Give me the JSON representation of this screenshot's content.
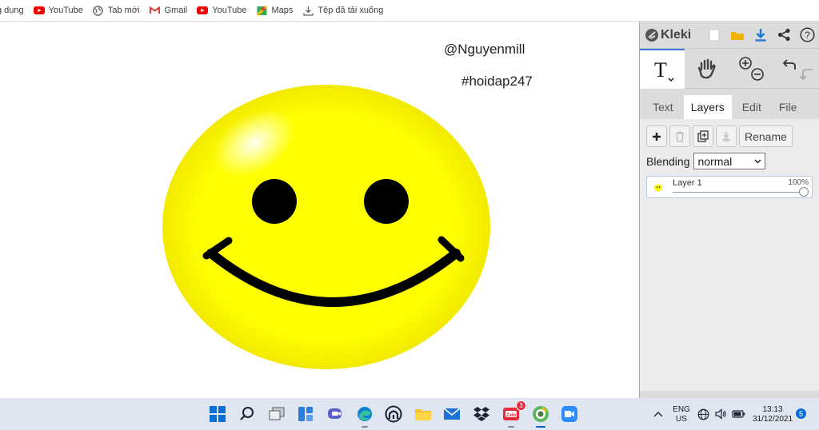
{
  "bookmarks": [
    {
      "label": "g dụng",
      "icon": "apps-icon"
    },
    {
      "label": "YouTube",
      "icon": "youtube-icon"
    },
    {
      "label": "Tab mới",
      "icon": "globe-icon"
    },
    {
      "label": "Gmail",
      "icon": "gmail-icon"
    },
    {
      "label": "YouTube",
      "icon": "youtube-icon"
    },
    {
      "label": "Maps",
      "icon": "maps-icon"
    },
    {
      "label": "Tệp đã tải xuống",
      "icon": "download-icon"
    }
  ],
  "canvas": {
    "text1": "@Nguyenmill",
    "text2": "#hoidap247",
    "colors": {
      "face": "#ffff00",
      "feature": "#000000"
    }
  },
  "panel": {
    "app_name": "Kleki",
    "tabs": [
      "Text",
      "Layers",
      "Edit",
      "File"
    ],
    "active_tab": "Layers",
    "rename_label": "Rename",
    "blending_label": "Blending",
    "blending_value": "normal",
    "layers": [
      {
        "name": "Layer 1",
        "opacity": "100%"
      }
    ],
    "accent": "#3a7bd5"
  },
  "taskbar": {
    "zalo_badge": "3",
    "lang": "ENG",
    "region": "US",
    "time": "13:13",
    "date": "31/12/2021",
    "notif_count": "5"
  }
}
